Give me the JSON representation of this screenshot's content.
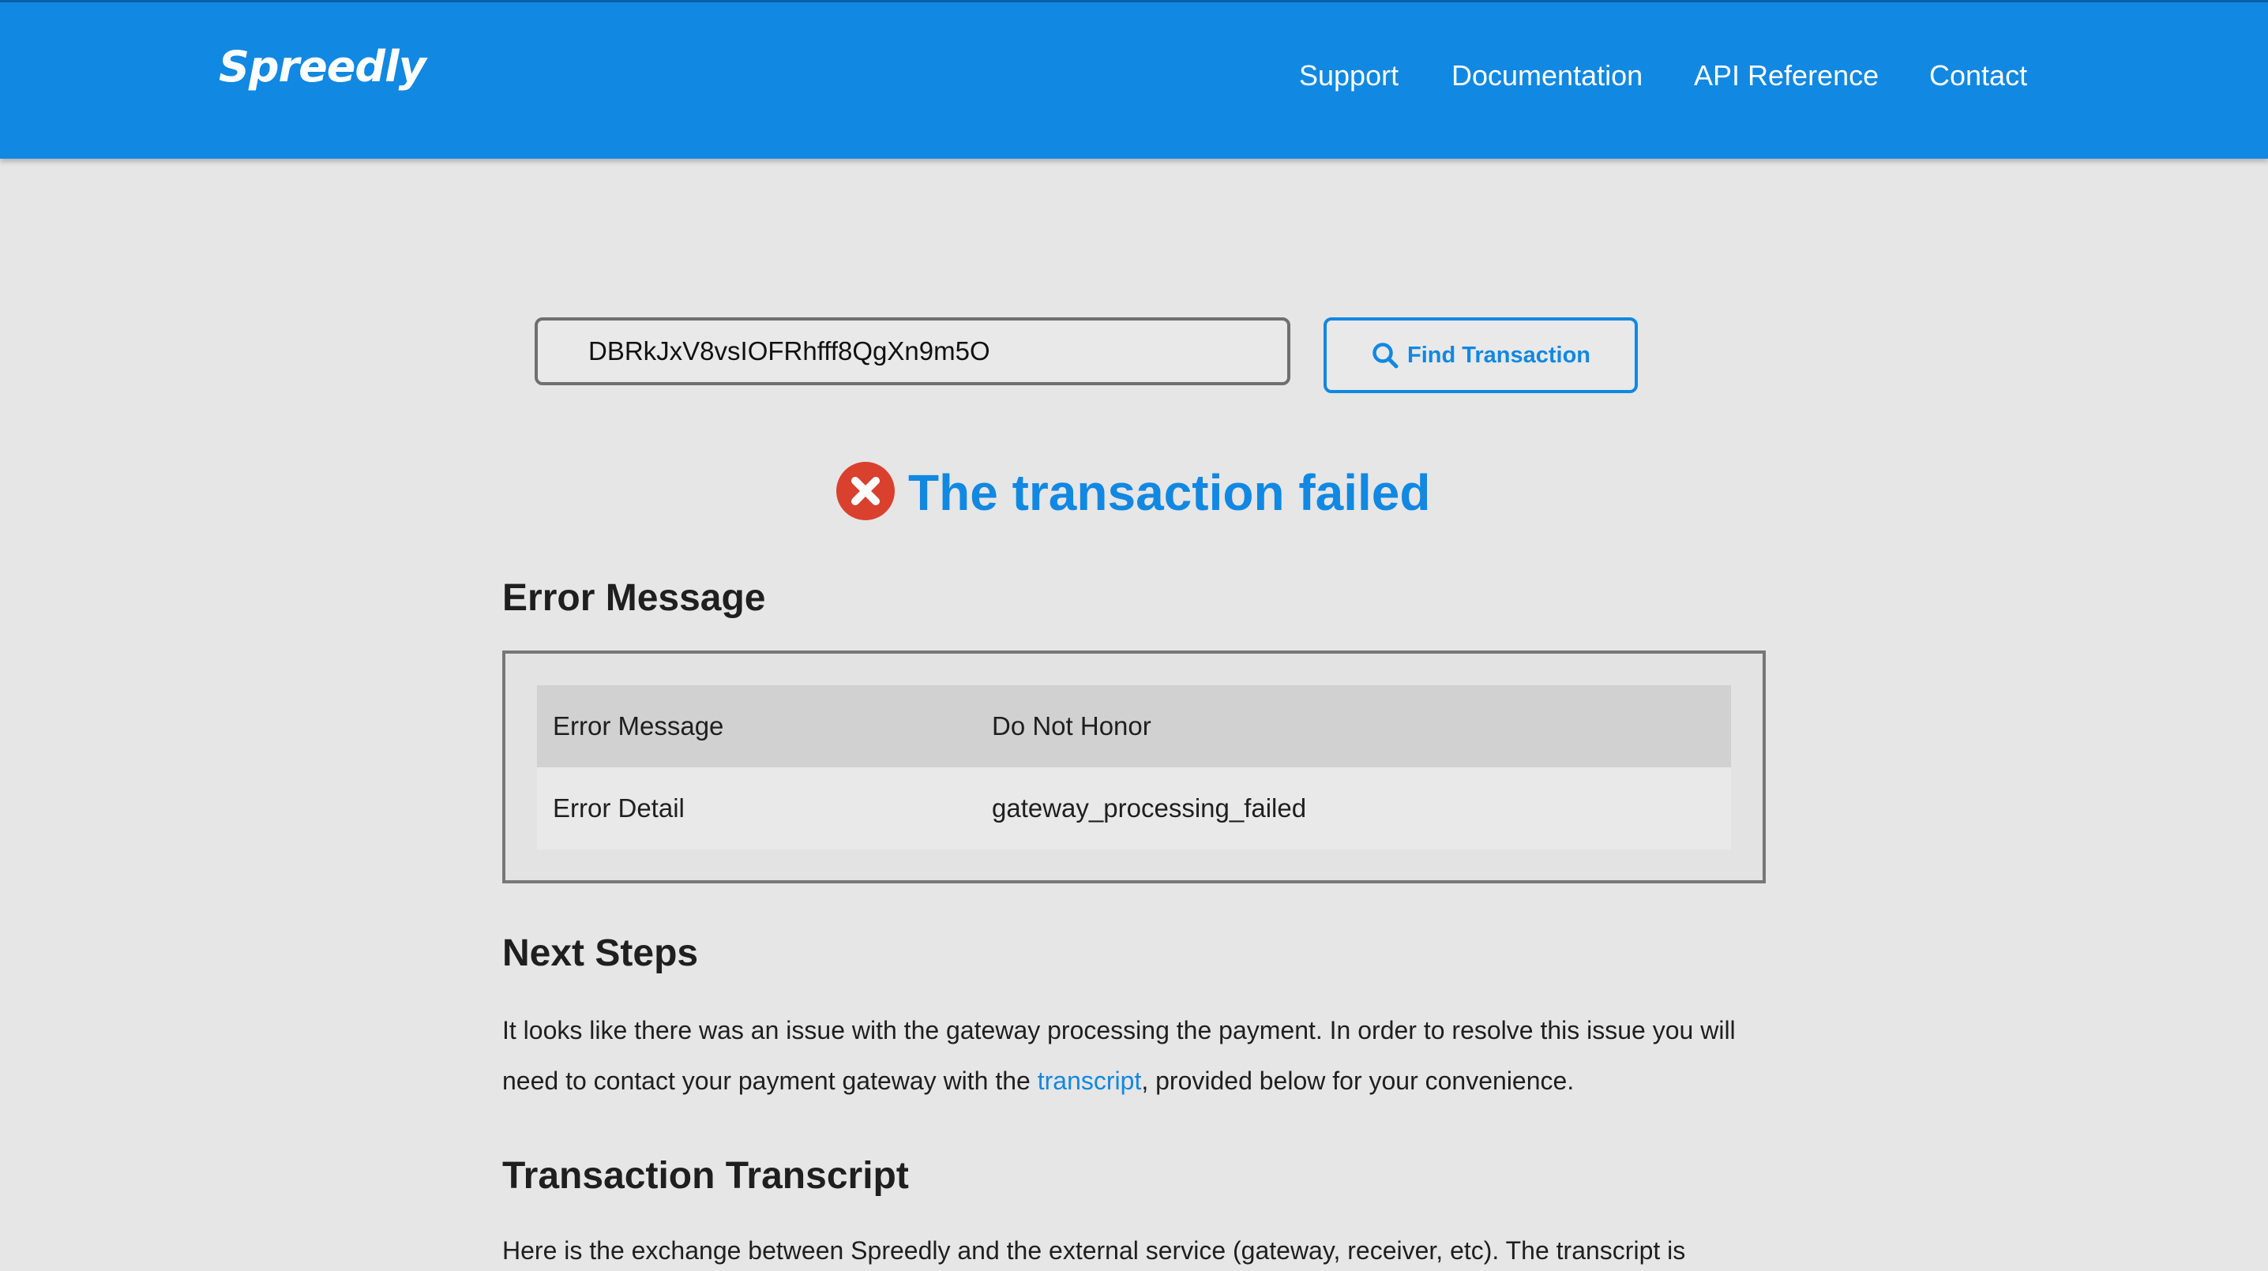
{
  "header": {
    "logo": "Spreedly",
    "nav": [
      "Support",
      "Documentation",
      "API Reference",
      "Contact"
    ]
  },
  "search": {
    "value": "DBRkJxV8vsIOFRhfff8QgXn9m5O",
    "button_label": "Find Transaction"
  },
  "status": {
    "title": "The transaction failed",
    "icon": "error-x-icon",
    "icon_color": "#d9412e"
  },
  "error_section": {
    "heading": "Error Message",
    "rows": [
      {
        "label": "Error Message",
        "value": "Do Not Honor"
      },
      {
        "label": "Error Detail",
        "value": "gateway_processing_failed"
      }
    ]
  },
  "next_steps": {
    "heading": "Next Steps",
    "text_before": "It looks like there was an issue with the gateway processing the payment. In order to resolve this issue you will need to contact your payment gateway with the ",
    "link": "transcript",
    "text_after": ", provided below for your convenience."
  },
  "transcript": {
    "heading": "Transaction Transcript",
    "text": "Here is the exchange between Spreedly and the external service (gateway, receiver, etc). The transcript is"
  },
  "colors": {
    "accent": "#1188e2",
    "background": "#e6e6e6",
    "error": "#d9412e"
  }
}
